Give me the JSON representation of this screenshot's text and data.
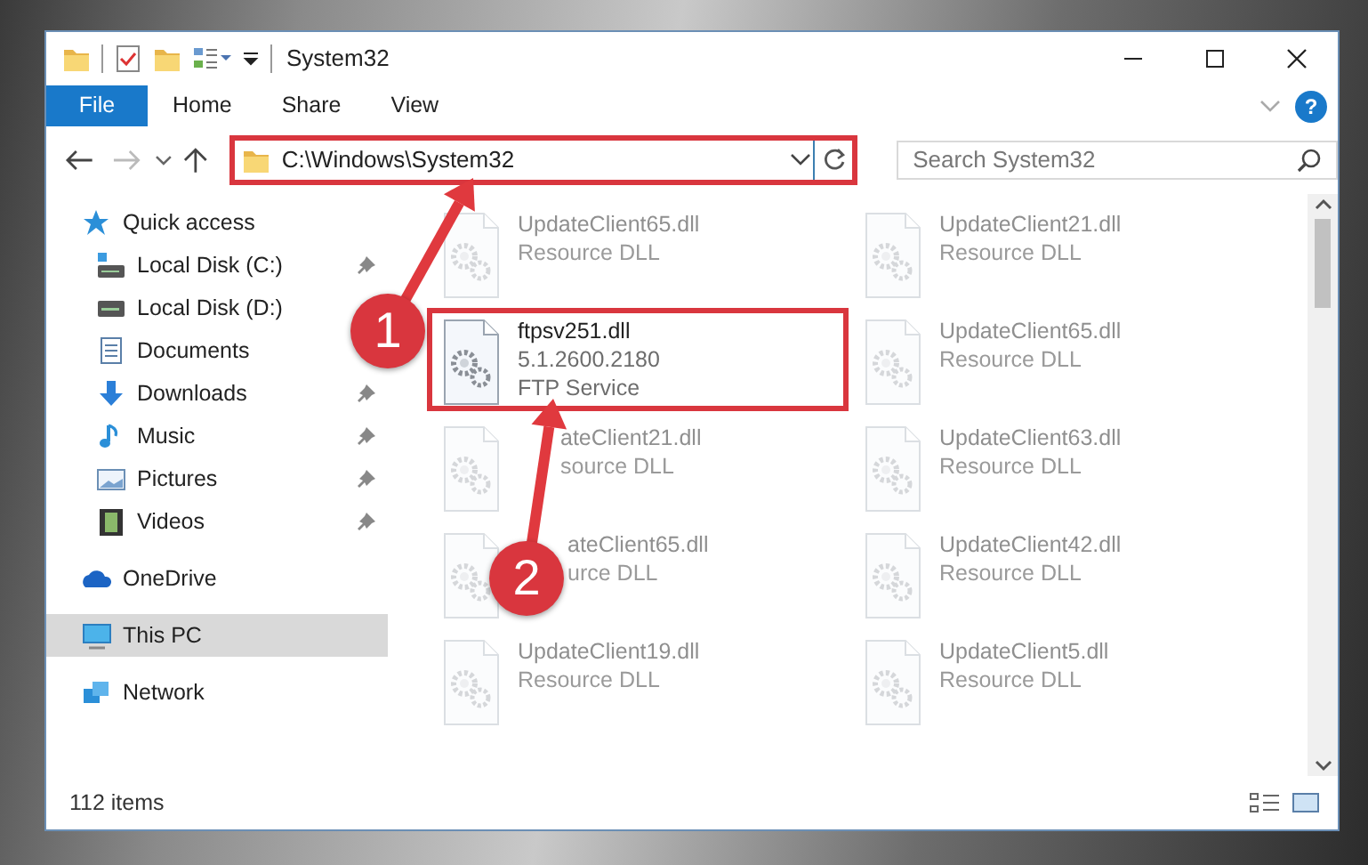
{
  "window": {
    "title": "System32"
  },
  "ribbon": {
    "tabs": [
      {
        "label": "File",
        "kind": "app"
      },
      {
        "label": "Home",
        "kind": "tab"
      },
      {
        "label": "Share",
        "kind": "tab"
      },
      {
        "label": "View",
        "kind": "tab"
      }
    ],
    "help": "?"
  },
  "address": {
    "path": "C:\\Windows\\System32",
    "highlighted": true
  },
  "search": {
    "placeholder": "Search System32"
  },
  "sidebar": {
    "items": [
      {
        "label": "Quick access",
        "kind": "star",
        "selected": false,
        "children": [
          {
            "label": "Local Disk (C:)",
            "kind": "drive-c",
            "pinned": true
          },
          {
            "label": "Local Disk (D:)",
            "kind": "drive",
            "pinned": false
          },
          {
            "label": "Documents",
            "kind": "documents",
            "pinned": false
          },
          {
            "label": "Downloads",
            "kind": "downloads",
            "pinned": true
          },
          {
            "label": "Music",
            "kind": "music",
            "pinned": true
          },
          {
            "label": "Pictures",
            "kind": "pictures",
            "pinned": true
          },
          {
            "label": "Videos",
            "kind": "videos",
            "pinned": true
          }
        ]
      },
      {
        "label": "OneDrive",
        "kind": "cloud",
        "selected": false
      },
      {
        "label": "This PC",
        "kind": "pc",
        "selected": true
      },
      {
        "label": "Network",
        "kind": "network",
        "selected": false
      }
    ]
  },
  "files": [
    {
      "name": "UpdateClient65.dll",
      "lines": [
        "Resource DLL"
      ],
      "faded": true,
      "highlighted": false
    },
    {
      "name": "UpdateClient21.dll",
      "lines": [
        "Resource DLL"
      ],
      "faded": true,
      "highlighted": false
    },
    {
      "name": "ftpsv251.dll",
      "lines": [
        "5.1.2600.2180",
        "FTP Service"
      ],
      "faded": false,
      "highlighted": true
    },
    {
      "name": "UpdateClient65.dll",
      "lines": [
        "Resource DLL"
      ],
      "faded": true,
      "highlighted": false
    },
    {
      "name": "ateClient21.dll",
      "lines": [
        "source DLL"
      ],
      "faded": true,
      "highlighted": false
    },
    {
      "name": "UpdateClient63.dll",
      "lines": [
        "Resource DLL"
      ],
      "faded": true,
      "highlighted": false
    },
    {
      "name": "ateClient65.dll",
      "lines": [
        "urce DLL"
      ],
      "faded": true,
      "highlighted": false
    },
    {
      "name": "UpdateClient42.dll",
      "lines": [
        "Resource DLL"
      ],
      "faded": true,
      "highlighted": false
    },
    {
      "name": "UpdateClient19.dll",
      "lines": [
        "Resource DLL"
      ],
      "faded": true,
      "highlighted": false
    },
    {
      "name": "UpdateClient5.dll",
      "lines": [
        "Resource DLL"
      ],
      "faded": true,
      "highlighted": false
    }
  ],
  "status_bar": {
    "count": "112 items"
  },
  "annotations": [
    {
      "number": "1"
    },
    {
      "number": "2"
    }
  ]
}
